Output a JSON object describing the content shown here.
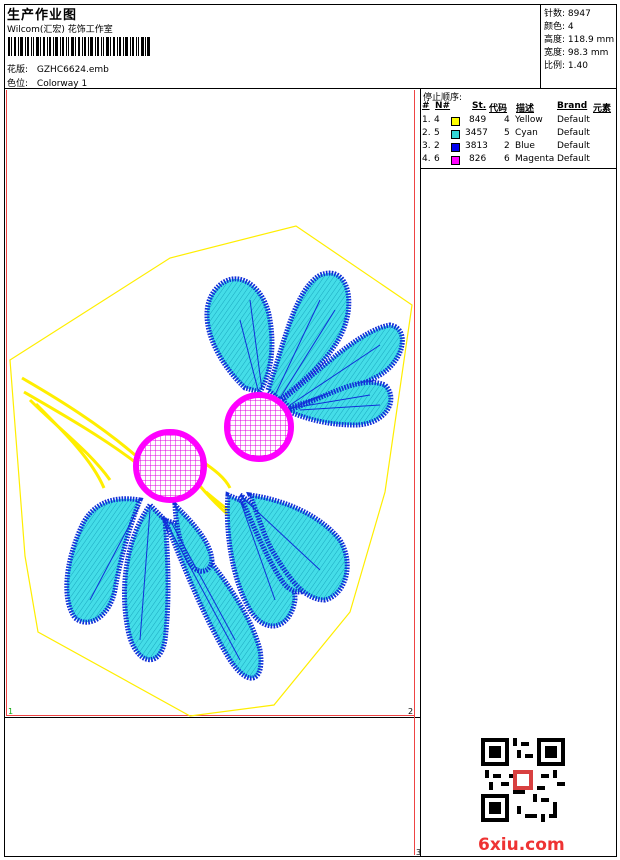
{
  "header": {
    "title": "生产作业图",
    "company": "Wilcom(汇宏) 花饰工作室",
    "design_label": "花版:",
    "design_value": "GZHC6624.emb",
    "colorway_label": "色位:",
    "colorway_value": "Colorway 1"
  },
  "stats": [
    {
      "label": "针数:",
      "value": "8947"
    },
    {
      "label": "颜色:",
      "value": "4"
    },
    {
      "label": "高度:",
      "value": "118.9 mm"
    },
    {
      "label": "宽度:",
      "value": "98.3 mm"
    },
    {
      "label": "比例:",
      "value": "1.40"
    }
  ],
  "stop_sequence": {
    "title": "停止顺序:",
    "headers": {
      "hash": "#",
      "no": "N#",
      "st": "St.",
      "code": "代码",
      "desc": "描述",
      "brand": "Brand",
      "element": "元素"
    },
    "rows": [
      {
        "idx": "1.",
        "n": "4",
        "color": "#ffff00",
        "st": "849",
        "code": "4",
        "desc": "Yellow",
        "brand": "Default"
      },
      {
        "idx": "2.",
        "n": "5",
        "color": "#33d6d6",
        "st": "3457",
        "code": "5",
        "desc": "Cyan",
        "brand": "Default"
      },
      {
        "idx": "3.",
        "n": "2",
        "color": "#0000ee",
        "st": "3813",
        "code": "2",
        "desc": "Blue",
        "brand": "Default"
      },
      {
        "idx": "4.",
        "n": "6",
        "color": "#ff00ff",
        "st": "826",
        "code": "6",
        "desc": "Magenta",
        "brand": "Default"
      }
    ]
  },
  "page_markers": {
    "one": "1",
    "two": "2",
    "three": "3"
  },
  "watermark": "6xiu.com",
  "colors": {
    "outline": "#ffee00",
    "petal_fill": "#44dde8",
    "petal_edge": "#1030d8",
    "center": "#ff00ff",
    "accent_red": "#ee4444"
  }
}
